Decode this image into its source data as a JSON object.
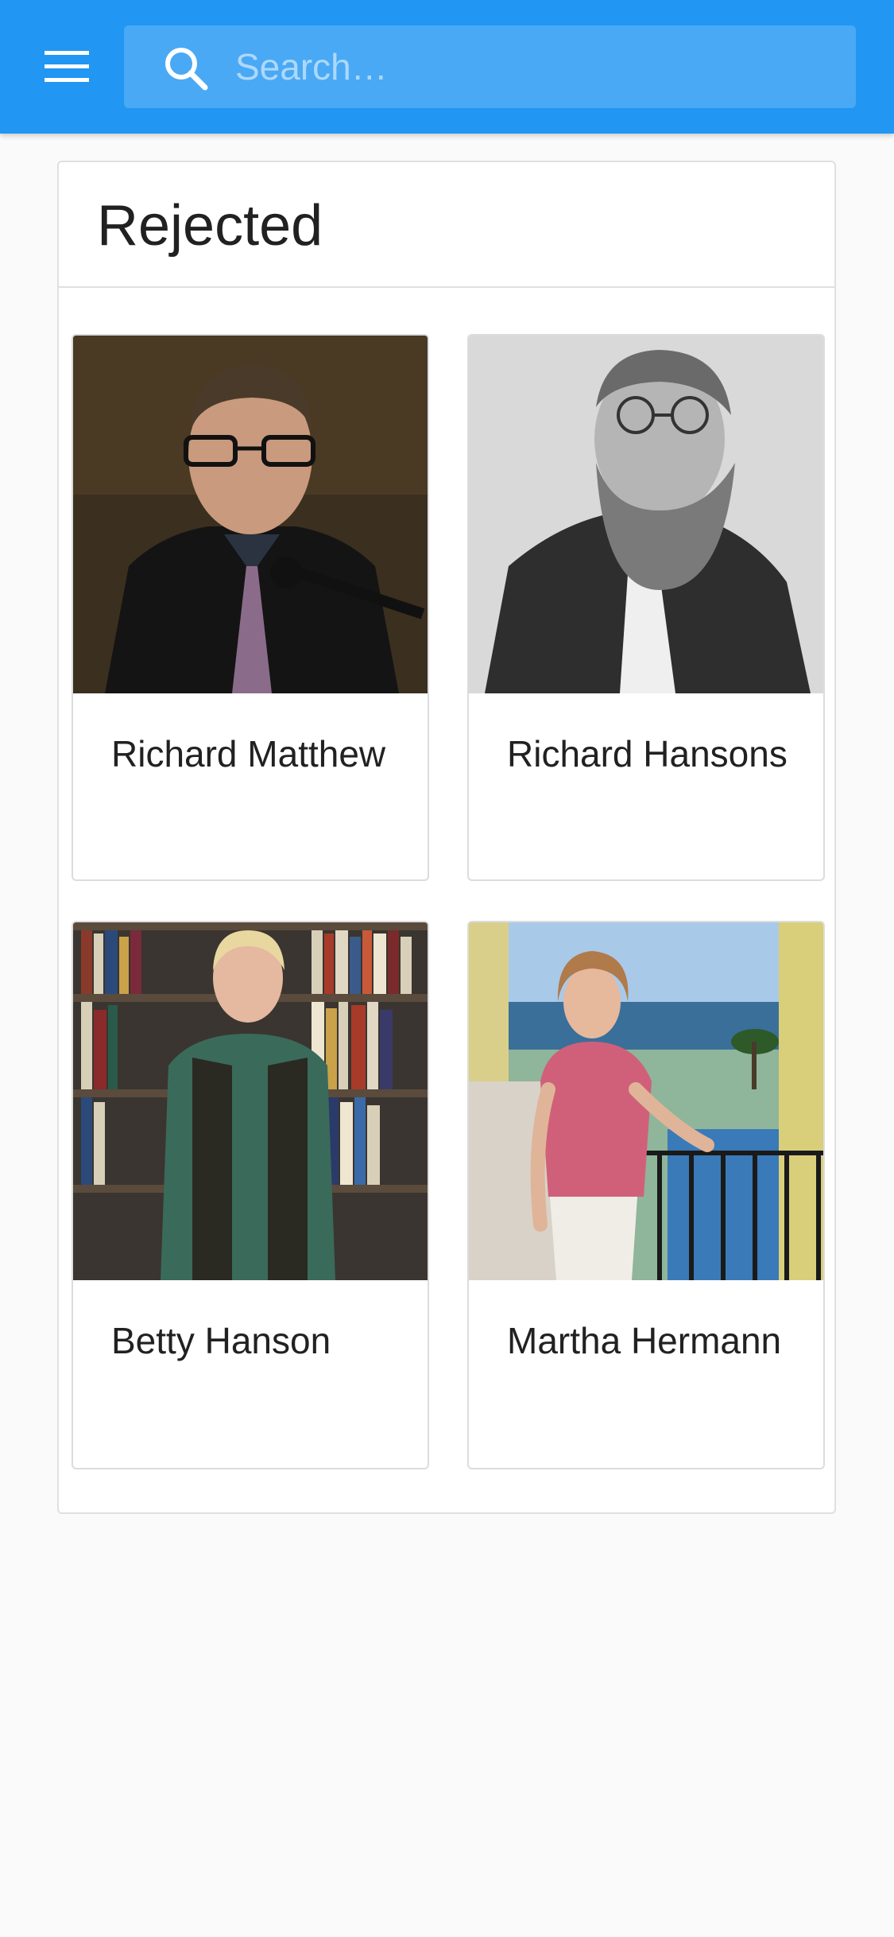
{
  "header": {
    "menu_icon": "hamburger-menu-icon",
    "search_icon": "search-icon",
    "search_placeholder": "Search…",
    "search_value": ""
  },
  "section": {
    "title": "Rejected"
  },
  "people": [
    {
      "name": "Richard Matthew"
    },
    {
      "name": "Richard Hansons"
    },
    {
      "name": "Betty Hanson"
    },
    {
      "name": "Martha Hermann"
    }
  ],
  "colors": {
    "app_bar": "#2196f3",
    "background": "#fafafa",
    "card_border": "#dcdcdc",
    "text_primary": "#212121"
  }
}
